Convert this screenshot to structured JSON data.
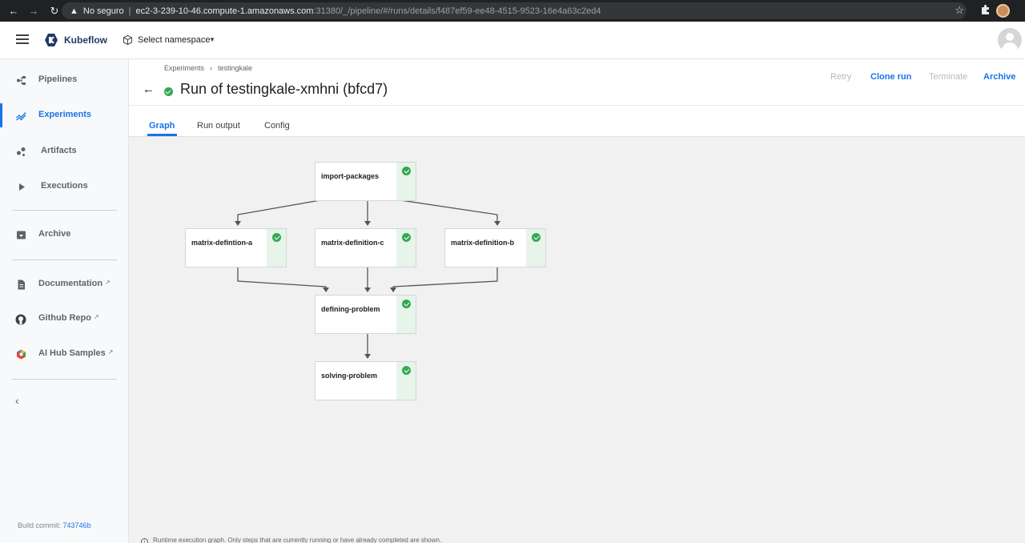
{
  "browser": {
    "insecure_label": "No seguro",
    "url_host": "ec2-3-239-10-46.compute-1.amazonaws.com",
    "url_path": ":31380/_/pipeline/#/runs/details/f487ef59-ee48-4515-9523-16e4a63c2ed4"
  },
  "appbar": {
    "brand": "Kubeflow",
    "namespace_label": "Select namespace"
  },
  "sidebar": {
    "items": [
      {
        "label": "Pipelines",
        "icon": "pipelines-icon"
      },
      {
        "label": "Experiments",
        "icon": "experiments-icon",
        "active": true
      },
      {
        "label": "Artifacts",
        "icon": "artifacts-icon"
      },
      {
        "label": "Executions",
        "icon": "executions-icon"
      },
      {
        "label": "Archive",
        "icon": "archive-icon"
      },
      {
        "label": "Documentation",
        "icon": "document-icon",
        "external": true
      },
      {
        "label": "Github Repo",
        "icon": "github-icon",
        "external": true
      },
      {
        "label": "AI Hub Samples",
        "icon": "ai-hub-icon",
        "external": true
      }
    ],
    "build_label": "Build commit:",
    "build_hash": "743746b"
  },
  "header": {
    "breadcrumb": [
      "Experiments",
      "testingkale"
    ],
    "title": "Run of testingkale-xmhni (bfcd7)",
    "status": "succeeded",
    "actions": {
      "retry": "Retry",
      "clone": "Clone run",
      "terminate": "Terminate",
      "archive": "Archive"
    }
  },
  "tabs": [
    "Graph",
    "Run output",
    "Config"
  ],
  "graph": {
    "nodes": [
      {
        "label": "import-packages",
        "status": "succeeded"
      },
      {
        "label": "matrix-defintion-a",
        "status": "succeeded"
      },
      {
        "label": "matrix-definition-c",
        "status": "succeeded"
      },
      {
        "label": "matrix-definition-b",
        "status": "succeeded"
      },
      {
        "label": "defining-problem",
        "status": "succeeded"
      },
      {
        "label": "solving-problem",
        "status": "succeeded"
      }
    ],
    "note": "Runtime execution graph. Only steps that are currently running or have already completed are shown."
  },
  "colors": {
    "accent": "#1a73e8",
    "success": "#34a853",
    "success_bg": "#e6f4ea"
  }
}
